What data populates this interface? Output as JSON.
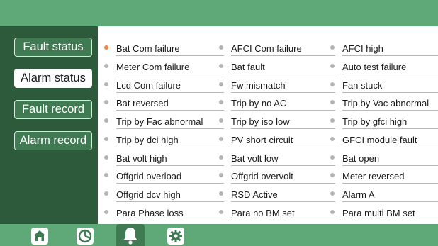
{
  "sidebar": {
    "items": [
      {
        "label": "Fault status"
      },
      {
        "label": "Alarm status"
      },
      {
        "label": "Fault record"
      },
      {
        "label": "Alarm record"
      }
    ],
    "active": "Alarm status"
  },
  "alarms": [
    {
      "label": "Bat Com failure",
      "active": true
    },
    {
      "label": "AFCI Com failure",
      "active": false
    },
    {
      "label": "AFCI high",
      "active": false
    },
    {
      "label": "Meter Com failure",
      "active": false
    },
    {
      "label": "Bat fault",
      "active": false
    },
    {
      "label": "Auto test failure",
      "active": false
    },
    {
      "label": "Lcd Com failure",
      "active": false
    },
    {
      "label": "Fw mismatch",
      "active": false
    },
    {
      "label": "Fan stuck",
      "active": false
    },
    {
      "label": "Bat reversed",
      "active": false
    },
    {
      "label": "Trip by no AC",
      "active": false
    },
    {
      "label": "Trip by Vac abnormal",
      "active": false
    },
    {
      "label": "Trip by Fac abnormal",
      "active": false
    },
    {
      "label": "Trip by iso low",
      "active": false
    },
    {
      "label": "Trip by gfci high",
      "active": false
    },
    {
      "label": "Trip by dci high",
      "active": false
    },
    {
      "label": "PV short circuit",
      "active": false
    },
    {
      "label": "GFCI module fault",
      "active": false
    },
    {
      "label": "Bat volt high",
      "active": false
    },
    {
      "label": "Bat volt low",
      "active": false
    },
    {
      "label": "Bat open",
      "active": false
    },
    {
      "label": "Offgrid overload",
      "active": false
    },
    {
      "label": "Offgrid overvolt",
      "active": false
    },
    {
      "label": "Meter reversed",
      "active": false
    },
    {
      "label": "Offgrid dcv high",
      "active": false
    },
    {
      "label": "RSD Active",
      "active": false
    },
    {
      "label": "Alarm A",
      "active": false
    },
    {
      "label": "Para Phase loss",
      "active": false
    },
    {
      "label": "Para no BM set",
      "active": false
    },
    {
      "label": "Para multi BM set",
      "active": false
    }
  ],
  "bottom_nav": [
    {
      "icon": "home-icon",
      "active": false
    },
    {
      "icon": "pie-chart-icon",
      "active": false
    },
    {
      "icon": "bell-icon",
      "active": true
    },
    {
      "icon": "gear-icon",
      "active": false
    }
  ],
  "colors": {
    "header": "#5fa878",
    "sidebar": "#2d5a3a",
    "button": "#3f7a52",
    "active_dot": "#ef8046",
    "inactive_dot": "#b4b4b4"
  }
}
